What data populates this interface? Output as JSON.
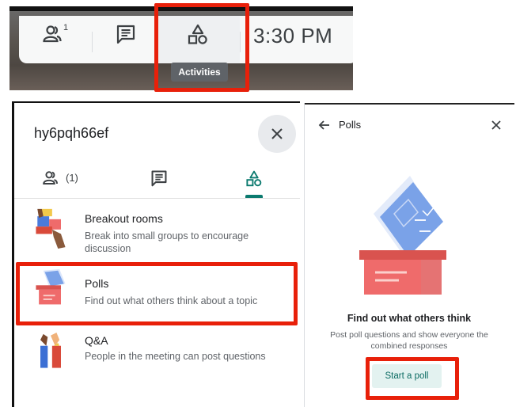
{
  "toolbar": {
    "people_badge": "1",
    "clock": "3:30 PM",
    "activities_tooltip": "Activities"
  },
  "side_panel": {
    "meeting_code": "hy6pqh66ef",
    "tabs": [
      {
        "name": "people",
        "count": "(1)"
      },
      {
        "name": "chat"
      },
      {
        "name": "activities"
      }
    ],
    "activities": [
      {
        "title": "Breakout rooms",
        "description": "Break into small groups to encourage discussion"
      },
      {
        "title": "Polls",
        "description": "Find out what others think about a topic"
      },
      {
        "title": "Q&A",
        "description": "People in the meeting can post questions"
      }
    ]
  },
  "polls_panel": {
    "title": "Polls",
    "heading": "Find out what others think",
    "description": "Post poll questions and show everyone the combined responses",
    "start_button": "Start a poll"
  },
  "colors": {
    "highlight_red": "#e8200a",
    "accent_teal": "#0b7a6f",
    "poll_blue": "#7aa2e8",
    "box_red": "#ef6b6b"
  }
}
